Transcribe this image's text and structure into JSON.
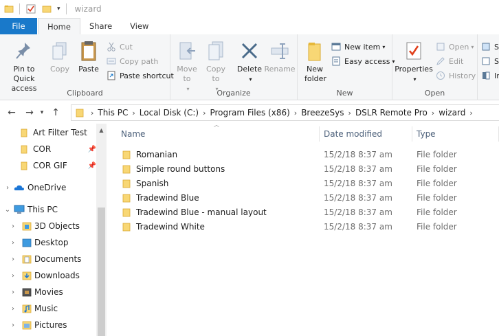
{
  "window": {
    "title": "wizard"
  },
  "tabs": [
    {
      "label": "File"
    },
    {
      "label": "Home"
    },
    {
      "label": "Share"
    },
    {
      "label": "View"
    }
  ],
  "ribbon": {
    "clipboard": {
      "label": "Clipboard",
      "pin": "Pin to Quick access",
      "copy": "Copy",
      "paste": "Paste",
      "cut": "Cut",
      "copy_path": "Copy path",
      "paste_shortcut": "Paste shortcut"
    },
    "organize": {
      "label": "Organize",
      "move_to": "Move to",
      "copy_to": "Copy to",
      "delete": "Delete",
      "rename": "Rename"
    },
    "new": {
      "label": "New",
      "new_folder": "New folder",
      "new_item": "New item",
      "easy_access": "Easy access"
    },
    "open": {
      "label": "Open",
      "properties": "Properties",
      "open": "Open",
      "edit": "Edit",
      "history": "History"
    },
    "select": {
      "s1": "S",
      "s2": "S",
      "s3": "In"
    }
  },
  "address": {
    "crumbs": [
      "This PC",
      "Local Disk (C:)",
      "Program Files (x86)",
      "BreezeSys",
      "DSLR Remote Pro",
      "wizard"
    ]
  },
  "nav": {
    "quick": [
      {
        "label": "Art Filter Test"
      },
      {
        "label": "COR"
      },
      {
        "label": "COR GIF"
      }
    ],
    "onedrive": "OneDrive",
    "thispc": "This PC",
    "pc_items": [
      {
        "label": "3D Objects"
      },
      {
        "label": "Desktop"
      },
      {
        "label": "Documents"
      },
      {
        "label": "Downloads"
      },
      {
        "label": "Movies"
      },
      {
        "label": "Music"
      },
      {
        "label": "Pictures"
      }
    ]
  },
  "columns": {
    "name": "Name",
    "date": "Date modified",
    "type": "Type"
  },
  "files": [
    {
      "name": "Romanian",
      "date": "15/2/18 8:37 am",
      "type": "File folder"
    },
    {
      "name": "Simple round buttons",
      "date": "15/2/18 8:37 am",
      "type": "File folder"
    },
    {
      "name": "Spanish",
      "date": "15/2/18 8:37 am",
      "type": "File folder"
    },
    {
      "name": "Tradewind Blue",
      "date": "15/2/18 8:37 am",
      "type": "File folder"
    },
    {
      "name": "Tradewind Blue - manual layout",
      "date": "15/2/18 8:37 am",
      "type": "File folder"
    },
    {
      "name": "Tradewind White",
      "date": "15/2/18 8:37 am",
      "type": "File folder"
    }
  ],
  "colors": {
    "accent": "#1979ca",
    "folder": "#f8d775",
    "folder_dark": "#e6b83a"
  }
}
